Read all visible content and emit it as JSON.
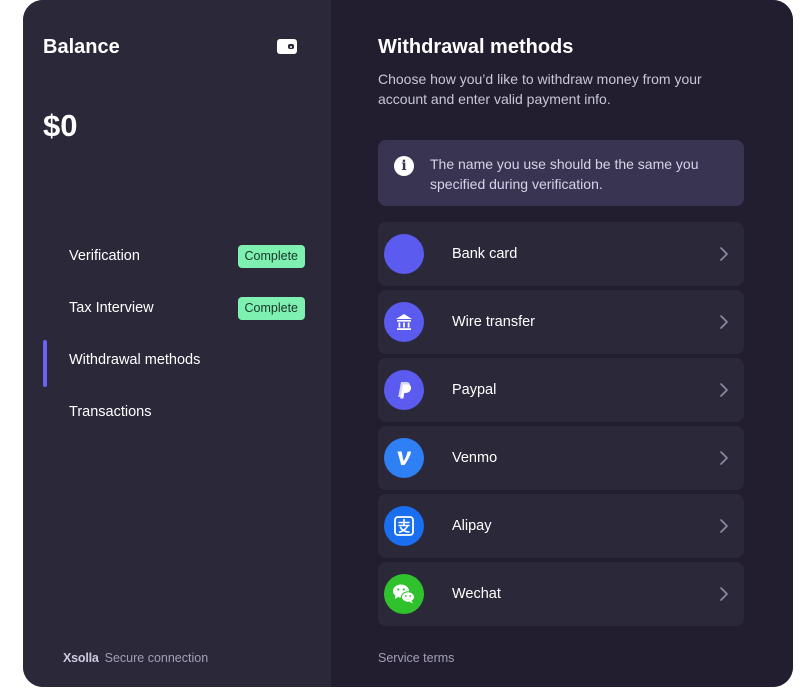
{
  "sidebar": {
    "balance_label": "Balance",
    "balance_amount": "$0",
    "wallet_icon": "wallet-icon",
    "steps": [
      {
        "label": "Verification",
        "badge": "Complete"
      },
      {
        "label": "Tax Interview",
        "badge": "Complete"
      },
      {
        "label": "Withdrawal methods",
        "active": true
      },
      {
        "label": "Transactions"
      }
    ],
    "footer": {
      "logo": "Xsolla",
      "text": "Secure connection"
    }
  },
  "main": {
    "title": "Withdrawal methods",
    "subtitle": "Choose how you’d like to withdraw money from your account and enter valid payment info.",
    "info": {
      "icon": "info-icon",
      "text": "The name you use should be the same you specified during verification."
    },
    "methods": [
      {
        "label": "Bank card",
        "icon": "bank-card-icon",
        "color": "#5b5bf0"
      },
      {
        "label": "Wire transfer",
        "icon": "bank-building-icon",
        "color": "#5b5bf0"
      },
      {
        "label": "Paypal",
        "icon": "paypal-icon",
        "color": "#5b5bf0"
      },
      {
        "label": "Venmo",
        "icon": "venmo-icon",
        "color": "#2f7ff5"
      },
      {
        "label": "Alipay",
        "icon": "alipay-icon",
        "color": "#1a6ff0"
      },
      {
        "label": "Wechat",
        "icon": "wechat-icon",
        "color": "#2fc22d"
      }
    ],
    "footer": {
      "text": "Service terms"
    }
  },
  "colors": {
    "sidebar_bg": "#2b2839",
    "main_bg": "#221e30",
    "accent": "#6a63f5",
    "badge_bg": "#7ef0b0",
    "info_bg": "#3a3453"
  }
}
